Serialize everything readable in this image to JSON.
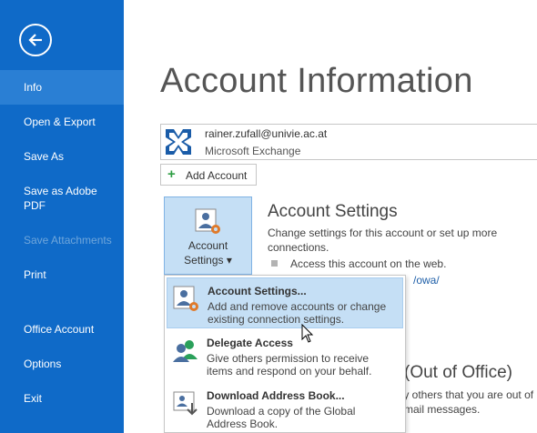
{
  "sidebar": {
    "items": [
      {
        "label": "Info"
      },
      {
        "label": "Open & Export"
      },
      {
        "label": "Save As"
      },
      {
        "label": "Save as Adobe PDF"
      },
      {
        "label": "Save Attachments"
      },
      {
        "label": "Print"
      },
      {
        "label": "Office Account"
      },
      {
        "label": "Options"
      },
      {
        "label": "Exit"
      }
    ],
    "active": "Info",
    "disabled": "Save Attachments"
  },
  "main": {
    "title": "Account Information",
    "account": {
      "email": "rainer.zufall@univie.ac.at",
      "type": "Microsoft Exchange",
      "icon": "exchange-icon"
    },
    "add_account_label": "Add Account",
    "settings_button": {
      "label_line1": "Account",
      "label_line2": "Settings ▾"
    },
    "account_settings": {
      "title": "Account Settings",
      "description": "Change settings for this account or set up more connections.",
      "bullet": "Access this account on the web.",
      "link_fragment": "/owa/"
    },
    "out_of_office": {
      "title": "(Out of Office)",
      "line1": "fy others that you are out of",
      "line2": "-mail messages."
    }
  },
  "dropdown": {
    "items": [
      {
        "title": "Account Settings...",
        "description": "Add and remove accounts or change existing connection settings.",
        "icon": "account-settings-icon"
      },
      {
        "title": "Delegate Access",
        "description": "Give others permission to receive items and respond on your behalf.",
        "icon": "delegate-people-icon"
      },
      {
        "title": "Download Address Book...",
        "description": "Download a copy of the Global Address Book.",
        "icon": "address-book-icon"
      }
    ]
  },
  "colors": {
    "sidebar_bg": "#0f6ac8",
    "sidebar_active": "#2a7fd4",
    "highlight": "#c5dff5",
    "link": "#1e5fa8"
  }
}
